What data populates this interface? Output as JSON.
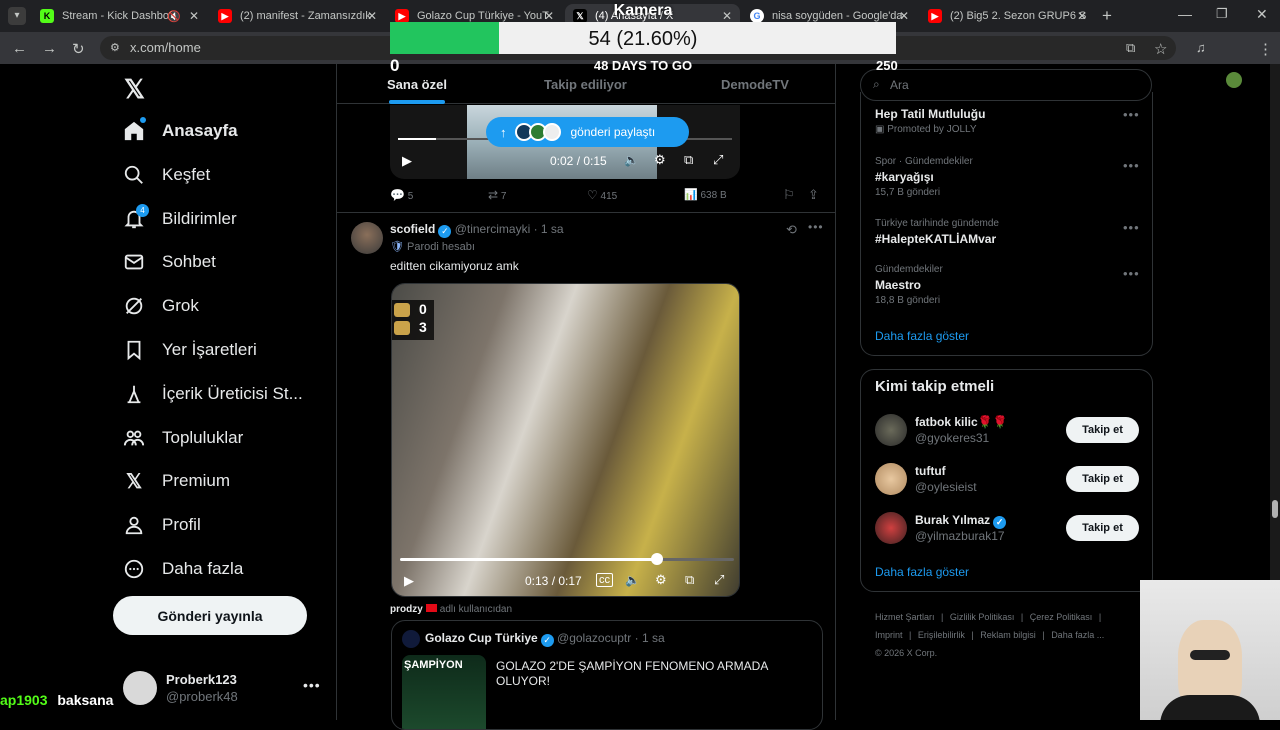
{
  "browser": {
    "tabs": [
      {
        "title": "Stream - Kick Dashboa",
        "icon": "kick-icon"
      },
      {
        "title": "(2) manifest - Zamansızdık",
        "icon": "youtube-icon"
      },
      {
        "title": "Golazo Cup Türkiye - YouT",
        "icon": "youtube-icon"
      },
      {
        "title": "(4) Anasayfa / X",
        "icon": "x-icon"
      },
      {
        "title": "nisa soygüden - Google'da",
        "icon": "google-icon"
      },
      {
        "title": "(2) Big5 2. Sezon GRUP6 S",
        "icon": "youtube-icon"
      }
    ],
    "url": "x.com/home"
  },
  "overlay": {
    "title": "Kamera",
    "progress_label": "54 (21.60%)",
    "progress_value": 54,
    "progress_max": 250,
    "min_label": "0",
    "max_label": "250",
    "days_label": "48 DAYS TO GO"
  },
  "sidebar": {
    "items": [
      {
        "label": "Anasayfa",
        "icon": "home-icon"
      },
      {
        "label": "Keşfet",
        "icon": "search-icon"
      },
      {
        "label": "Bildirimler",
        "icon": "bell-icon",
        "badge": "4"
      },
      {
        "label": "Sohbet",
        "icon": "mail-icon"
      },
      {
        "label": "Grok",
        "icon": "grok-icon"
      },
      {
        "label": "Yer İşaretleri",
        "icon": "bookmark-icon"
      },
      {
        "label": "İçerik Üreticisi St...",
        "icon": "creator-icon"
      },
      {
        "label": "Topluluklar",
        "icon": "communities-icon"
      },
      {
        "label": "Premium",
        "icon": "x-icon"
      },
      {
        "label": "Profil",
        "icon": "person-icon"
      },
      {
        "label": "Daha fazla",
        "icon": "more-icon"
      }
    ],
    "post_button": "Gönderi yayınla",
    "account": {
      "name": "Proberk123",
      "handle": "@proberk48"
    }
  },
  "feed": {
    "tabs": [
      "Sana özel",
      "Takip ediliyor",
      "DemodeTV"
    ],
    "post1": {
      "share_pill": "gönderi paylaştı",
      "time": "0:02 / 0:15",
      "stats": {
        "replies": "5",
        "reposts": "7",
        "likes": "415",
        "views": "638 B"
      }
    },
    "post2": {
      "name": "scofield",
      "handle": "@tinercimayki",
      "time": "· 1 sa",
      "parody": "Parodi hesabı",
      "text": "editten cikamiyoruz amk",
      "score_top": "0",
      "score_bottom": "3",
      "video_time": "0:13 / 0:17",
      "video_progress": 0.77,
      "via_user": "prodzy",
      "via_text": "adlı kullanıcıdan"
    },
    "quote": {
      "name": "Golazo Cup Türkiye",
      "handle": "@golazocuptr",
      "time": "· 1 sa",
      "text": "GOLAZO 2'DE ŞAMPİYON FENOMENO ARMADA OLUYOR!",
      "thumb_text": "ŞAMPİYON"
    }
  },
  "search": {
    "placeholder": "Ara"
  },
  "trends": [
    {
      "context": "",
      "title": "Hep Tatil Mutluluğu",
      "meta": "Promoted by JOLLY"
    },
    {
      "context": "Spor · Gündemdekiler",
      "title": "#karyağışı",
      "meta": "15,7 B gönderi"
    },
    {
      "context": "Türkiye tarihinde gündemde",
      "title": "#HalepteKATLİAMvar",
      "meta": ""
    },
    {
      "context": "Gündemdekiler",
      "title": "Maestro",
      "meta": "18,8 B gönderi"
    }
  ],
  "trends_more": "Daha fazla göster",
  "who_to_follow": {
    "title": "Kimi takip etmeli",
    "users": [
      {
        "name": "fatbok kilic🌹🌹",
        "handle": "@gyokeres31",
        "button": "Takip et",
        "verified": false
      },
      {
        "name": "tuftuf",
        "handle": "@oylesieist",
        "button": "Takip et",
        "verified": false
      },
      {
        "name": "Burak Yılmaz",
        "handle": "@yilmazburak17",
        "button": "Takip et",
        "verified": true
      }
    ],
    "more": "Daha fazla göster"
  },
  "footer": [
    "Hizmet Şartları",
    "Gizlilik Politikası",
    "Çerez Politikası",
    "Imprint",
    "Erişilebilirlik",
    "Reklam bilgisi",
    "Daha fazla ...",
    "© 2026 X Corp."
  ],
  "chat": {
    "user": "ap1903",
    "message": "baksana"
  },
  "colors": {
    "accent": "#1d9bf0",
    "goal_fill": "#22c55e",
    "background": "#000000"
  }
}
